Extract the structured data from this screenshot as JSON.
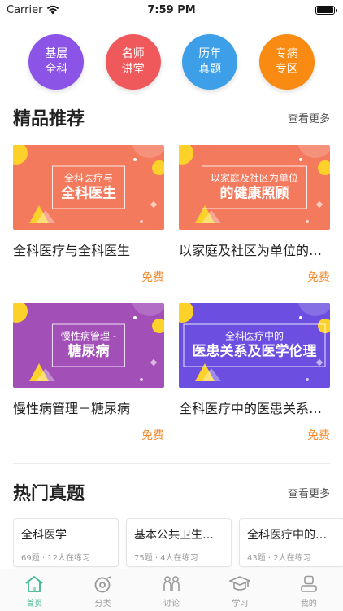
{
  "status_bar": {
    "carrier": "Carrier",
    "time": "7:59 PM"
  },
  "categories": [
    {
      "label": "基层全科",
      "color": "#8b53e6"
    },
    {
      "label": "名师讲堂",
      "color": "#f0595c"
    },
    {
      "label": "历年真题",
      "color": "#3c9fe8"
    },
    {
      "label": "专病专区",
      "color": "#f98a12"
    }
  ],
  "featured": {
    "title": "精品推荐",
    "more": "查看更多",
    "courses": [
      {
        "banner_line1": "全科医疗与",
        "banner_line2": "全科医生",
        "title": "全科医疗与全科医生",
        "price": "免费",
        "color": "#f47a5e"
      },
      {
        "banner_line1": "以家庭及社区为单位",
        "banner_line2": "的健康照顾",
        "title": "以家庭及社区为单位的健康照顾",
        "price": "免费",
        "color": "#f47a5e"
      },
      {
        "banner_line1": "慢性病管理 -",
        "banner_line2": "糖尿病",
        "title": "慢性病管理－糖尿病",
        "price": "免费",
        "color": "#a24fb8"
      },
      {
        "banner_line1": "全科医疗中的",
        "banner_line2": "医患关系及医学伦理",
        "title": "全科医疗中的医患关系及医学伦理",
        "price": "免费",
        "color": "#6c4fe0"
      }
    ]
  },
  "hot_exams": {
    "title": "热门真题",
    "more": "查看更多",
    "items": [
      {
        "title": "全科医学",
        "count": "69题",
        "practicing": "12人在练习"
      },
      {
        "title": "基本公共卫生服务",
        "count": "75题",
        "practicing": "4人在练习"
      },
      {
        "title": "全科医疗中的问题",
        "count": "43题",
        "practicing": "2人在练习"
      }
    ]
  },
  "tabs": [
    {
      "label": "首页",
      "icon": "home-icon",
      "active": true
    },
    {
      "label": "分类",
      "icon": "category-icon",
      "active": false
    },
    {
      "label": "讨论",
      "icon": "discussion-icon",
      "active": false
    },
    {
      "label": "学习",
      "icon": "study-icon",
      "active": false
    },
    {
      "label": "我的",
      "icon": "profile-icon",
      "active": false
    }
  ]
}
